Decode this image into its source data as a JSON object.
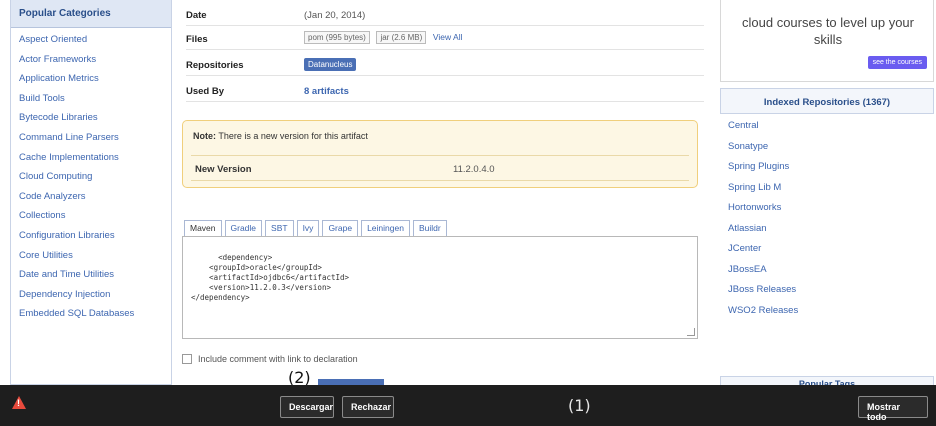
{
  "sidebar": {
    "heading": "Popular Categories",
    "items": [
      "Aspect Oriented",
      "Actor Frameworks",
      "Application Metrics",
      "Build Tools",
      "Bytecode Libraries",
      "Command Line Parsers",
      "Cache Implementations",
      "Cloud Computing",
      "Code Analyzers",
      "Collections",
      "Configuration Libraries",
      "Core Utilities",
      "Date and Time Utilities",
      "Dependency Injection",
      "Embedded SQL Databases"
    ]
  },
  "details": {
    "date_label": "Date",
    "date_value": "(Jan 20, 2014)",
    "files_label": "Files",
    "files_pom": "pom (995 bytes)",
    "files_jar": "jar (2.6 MB)",
    "files_view_all": "View All",
    "repositories_label": "Repositories",
    "repositories_value": "Datanucleus",
    "used_by_label": "Used By",
    "used_by_value": "8 artifacts"
  },
  "note": {
    "prefix": "Note:",
    "text": "There is a new version for this artifact",
    "new_version_label": "New Version",
    "new_version_value": "11.2.0.4.0"
  },
  "tabs": {
    "items": [
      "Maven",
      "Gradle",
      "SBT",
      "Ivy",
      "Grape",
      "Leiningen",
      "Buildr"
    ],
    "code": "<dependency>\n    <groupId>oracle</groupId>\n    <artifactId>ojdbc6</artifactId>\n    <version>11.2.0.3</version>\n</dependency>",
    "include_comment": "Include comment with link to declaration"
  },
  "ad": {
    "text": "cloud courses to level up your skills",
    "button": "see the courses"
  },
  "repos": {
    "heading": "Indexed Repositories (1367)",
    "items": [
      "Central",
      "Sonatype",
      "Spring Plugins",
      "Spring Lib M",
      "Hortonworks",
      "Atlassian",
      "JCenter",
      "JBossEA",
      "JBoss Releases",
      "WSO2 Releases"
    ],
    "popular_tags": "Popular Tags"
  },
  "markers": {
    "one": "(1)",
    "two": "(2)"
  },
  "consent_bar": {
    "decline": "Descargar",
    "refuse": "Rechazar",
    "show_all": "Mostrar todo"
  }
}
